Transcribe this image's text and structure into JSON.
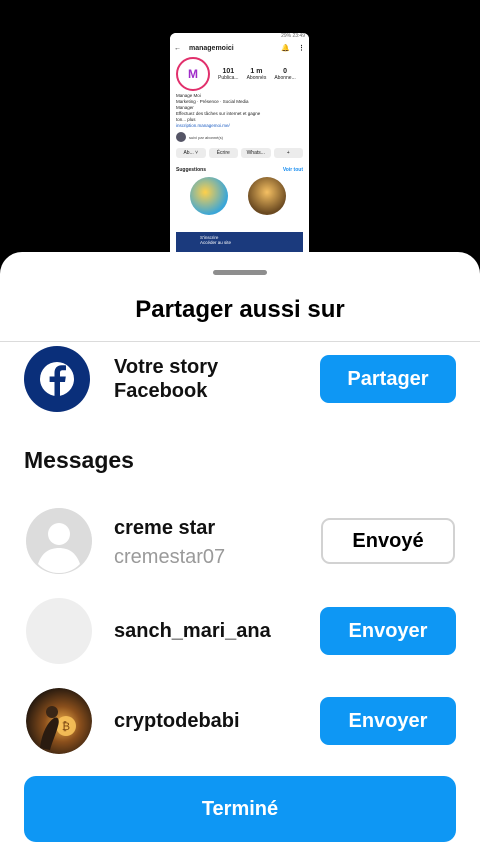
{
  "preview": {
    "status_text": "29% 23:49",
    "username": "managemoici",
    "logo_letter": "M",
    "stats": [
      {
        "value": "101",
        "label": "Publica..."
      },
      {
        "value": "1 m",
        "label": "Abonnés"
      },
      {
        "value": "0",
        "label": "Abonne..."
      }
    ],
    "bio_lines": [
      "Manage Moi",
      "Marketing · Présence · Social Media",
      "Manager",
      "Effectuez des tâches sur internet et gagne",
      "ton... plus"
    ],
    "bio_link": "inscription.managemoi.me/",
    "followed_by": "suivi par abonné(s)",
    "buttons": [
      "Ab... ˅",
      "Écrire",
      "Whats...",
      "+"
    ],
    "suggestions_label": "Suggestions",
    "see_all": "Voir tout",
    "ad_line1": "S'inscrire",
    "ad_line2": "Accéder au site"
  },
  "sheet": {
    "title": "Partager aussi sur",
    "facebook": {
      "line1": "Votre story",
      "line2": "Facebook",
      "button": "Partager"
    },
    "messages_title": "Messages",
    "contacts": [
      {
        "name": "creme star",
        "handle": "cremestar07",
        "button": "Envoyé",
        "sent": true
      },
      {
        "name": "sanch_mari_ana",
        "handle": "",
        "button": "Envoyer",
        "sent": false
      },
      {
        "name": "cryptodebabi",
        "handle": "",
        "button": "Envoyer",
        "sent": false
      }
    ],
    "done_button": "Terminé"
  },
  "colors": {
    "accent": "#0e97f4",
    "facebook": "#0a2f7a",
    "placeholder_avatar": "#e6e6e6"
  }
}
